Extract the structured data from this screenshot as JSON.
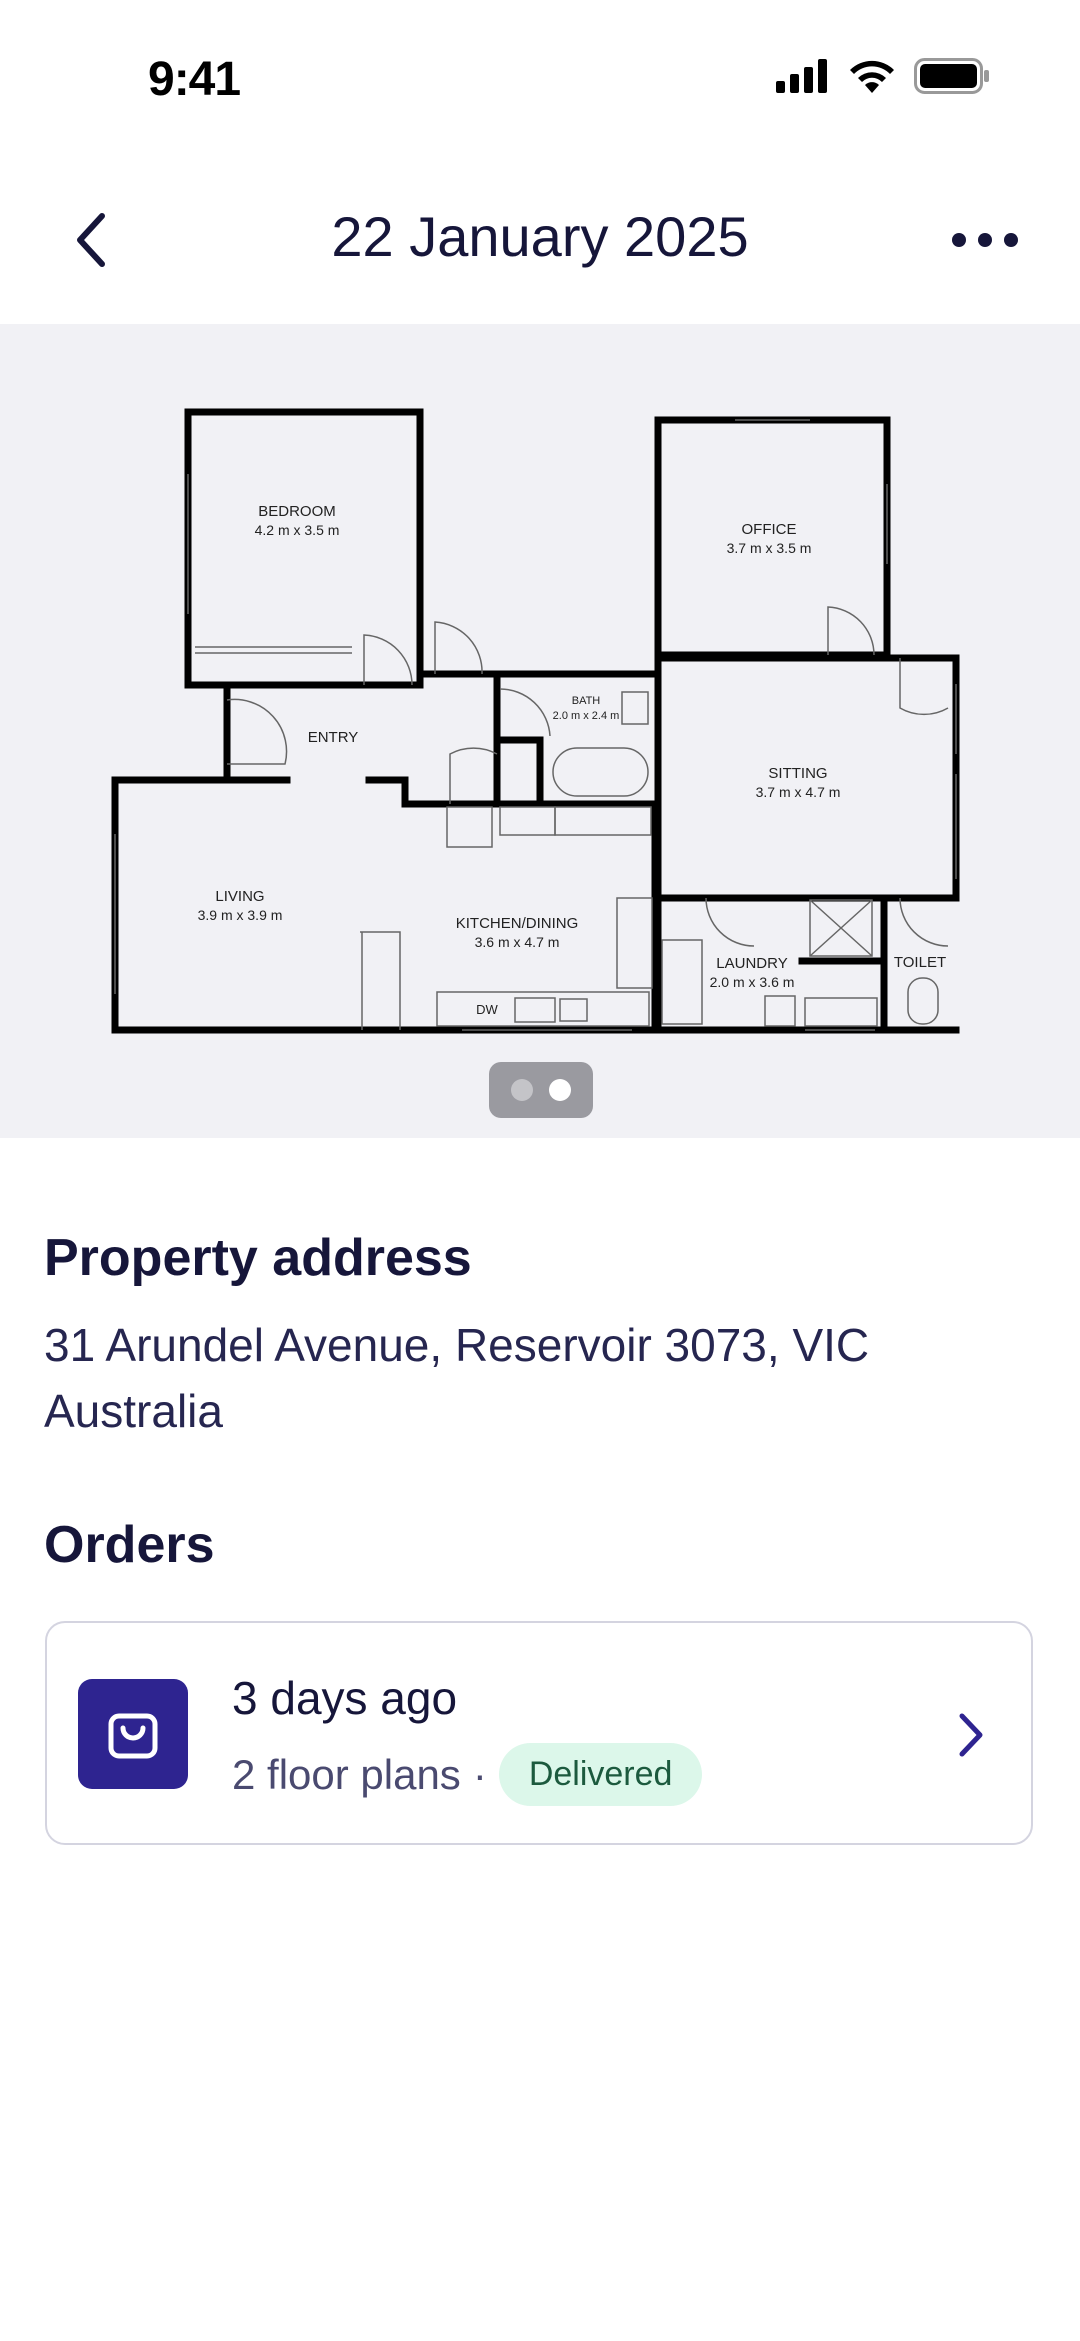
{
  "status_bar": {
    "time": "9:41"
  },
  "nav": {
    "title": "22 January 2025"
  },
  "floor_plan": {
    "rooms": [
      {
        "name": "BEDROOM",
        "size": "4.2 m x 3.5 m"
      },
      {
        "name": "OFFICE",
        "size": "3.7 m x 3.5 m"
      },
      {
        "name": "BATH",
        "size": "2.0 m x 2.4 m"
      },
      {
        "name": "ENTRY"
      },
      {
        "name": "SITTING",
        "size": "3.7 m x 4.7 m"
      },
      {
        "name": "LIVING",
        "size": "3.9 m x 3.9 m"
      },
      {
        "name": "KITCHEN/DINING",
        "size": "3.6 m x 4.7 m"
      },
      {
        "name": "LAUNDRY",
        "size": "2.0 m x 3.6 m"
      },
      {
        "name": "TOILET"
      },
      {
        "name": "DW"
      }
    ],
    "pager": {
      "page_count": 2,
      "current_page": 2
    }
  },
  "property": {
    "heading": "Property address",
    "address": "31 Arundel Avenue, Reservoir 3073, VIC Australia"
  },
  "orders": {
    "heading": "Orders",
    "items": [
      {
        "when": "3 days ago",
        "summary": "2 floor plans",
        "separator": "·",
        "status": "Delivered",
        "icon": "shopping-bag-icon"
      }
    ]
  },
  "colors": {
    "accent": "#2e2490",
    "text": "#16163a",
    "badge_bg": "#dcf7ea",
    "badge_text": "#1c5a3e",
    "plan_bg": "#f1f1f5"
  }
}
